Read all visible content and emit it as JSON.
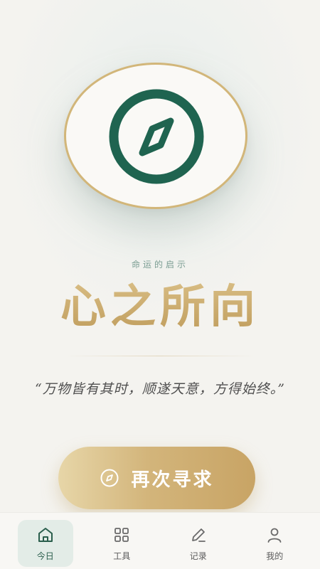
{
  "hero": {
    "icon": "compass-icon",
    "ring_color": "#d2b679",
    "icon_color": "#1f6450"
  },
  "subtitle": "命运的启示",
  "title": "心之所向",
  "quote": "“万物皆有其时，顺遂天意，方得始终。”",
  "seek_button": {
    "label": "再次寻求",
    "icon": "compass-icon"
  },
  "tabbar": {
    "active_index": 0,
    "items": [
      {
        "label": "今日",
        "icon": "home-icon"
      },
      {
        "label": "工具",
        "icon": "grid-icon"
      },
      {
        "label": "记录",
        "icon": "pen-icon"
      },
      {
        "label": "我的",
        "icon": "user-icon"
      }
    ]
  },
  "colors": {
    "accent_gold": "#c9ab72",
    "accent_green": "#1f6450",
    "background": "#f4f3ef"
  }
}
